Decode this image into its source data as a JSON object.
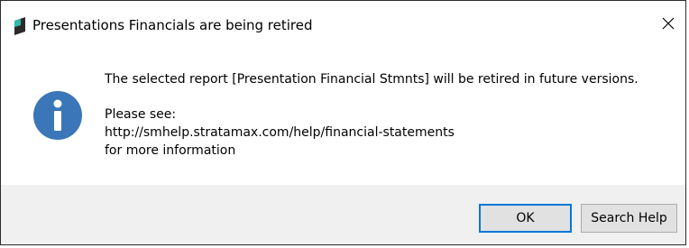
{
  "dialog": {
    "title": "Presentations Financials are being retired",
    "close_glyph": "✕",
    "message": {
      "line1": "The selected report [Presentation Financial Stmnts] will be retired in future versions.",
      "line2": "Please see:",
      "line3": "http://smhelp.stratamax.com/help/financial-statements",
      "line4": "for more information"
    },
    "buttons": {
      "ok": "OK",
      "search_help": "Search Help"
    },
    "icons": {
      "app": "app-logo-icon",
      "info": "info-icon",
      "close": "close-icon"
    }
  },
  "colors": {
    "info_blue": "#3a76b8",
    "footer_bg": "#f0f0f0",
    "default_button_border": "#0078d7"
  }
}
